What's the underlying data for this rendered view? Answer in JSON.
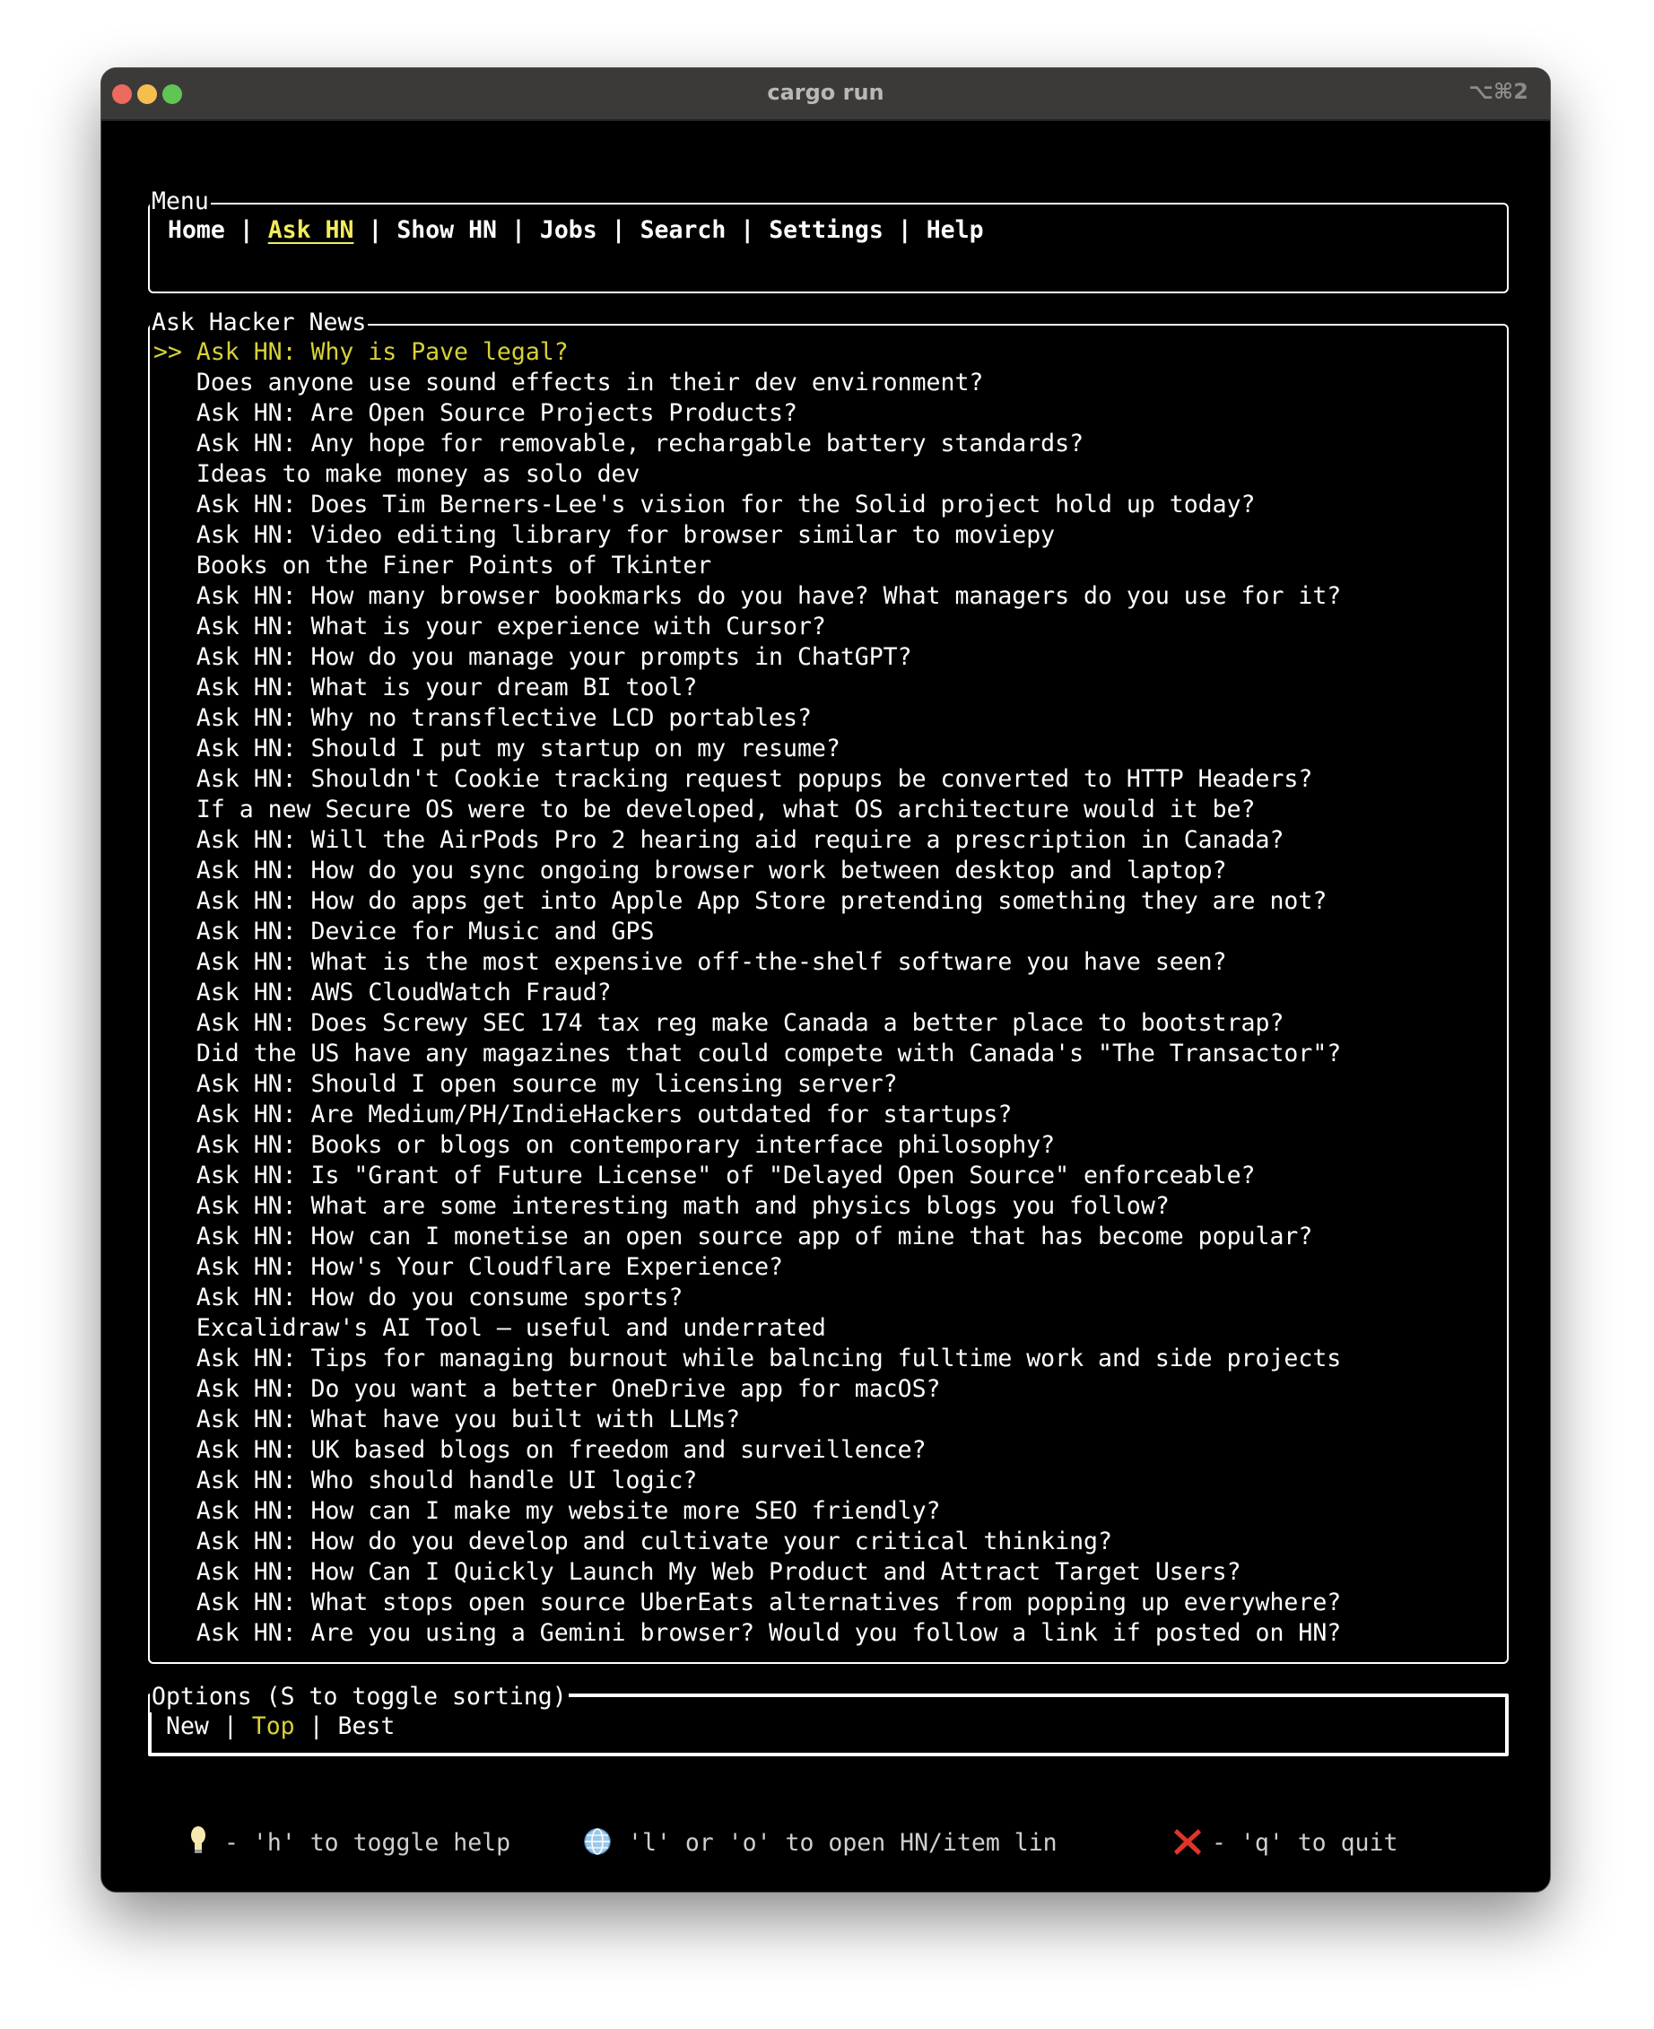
{
  "window": {
    "title": "cargo run",
    "shortcut": "⌥⌘2"
  },
  "menu": {
    "title": "Menu",
    "items": [
      "Home",
      "Ask HN",
      "Show HN",
      "Jobs",
      "Search",
      "Settings",
      "Help"
    ],
    "active": "Ask HN",
    "separator": "|"
  },
  "list": {
    "title": "Ask Hacker News",
    "cursor": ">>",
    "items": [
      "Ask HN: Why is Pave legal?",
      "Does anyone use sound effects in their dev environment?",
      "Ask HN: Are Open Source Projects Products?",
      "Ask HN: Any hope for removable, rechargable battery standards?",
      "Ideas to make money as solo dev",
      "Ask HN: Does Tim Berners-Lee's vision for the Solid project hold up today?",
      "Ask HN: Video editing library for browser similar to moviepy",
      "Books on the Finer Points of Tkinter",
      "Ask HN: How many browser bookmarks do you have? What managers do you use for it?",
      "Ask HN: What is your experience with Cursor?",
      "Ask HN: How do you manage your prompts in ChatGPT?",
      "Ask HN: What is your dream BI tool?",
      "Ask HN: Why no transflective LCD portables?",
      "Ask HN: Should I put my startup on my resume?",
      "Ask HN: Shouldn't Cookie tracking request popups be converted to HTTP Headers?",
      "If a new Secure OS were to be developed, what OS architecture would it be?",
      "Ask HN: Will the AirPods Pro 2 hearing aid require a prescription in Canada?",
      "Ask HN: How do you sync ongoing browser work between desktop and laptop?",
      "Ask HN: How do apps get into Apple App Store pretending something they are not?",
      "Ask HN: Device for Music and GPS",
      "Ask HN: What is the most expensive off-the-shelf software you have seen?",
      "Ask HN: AWS CloudWatch Fraud?",
      "Ask HN: Does Screwy SEC 174 tax reg make Canada a better place to bootstrap?",
      "Did the US have any magazines that could compete with Canada's \"The Transactor\"?",
      "Ask HN: Should I open source my licensing server?",
      "Ask HN: Are Medium/PH/IndieHackers outdated for startups?",
      "Ask HN: Books or blogs on contemporary interface philosophy?",
      "Ask HN: Is \"Grant of Future License\" of \"Delayed Open Source\" enforceable?",
      "Ask HN: What are some interesting math and physics blogs you follow?",
      "Ask HN: How can I monetise an open source app of mine that has become popular?",
      "Ask HN: How's Your Cloudflare Experience?",
      "Ask HN: How do you consume sports?",
      "Excalidraw's AI Tool – useful and underrated",
      "Ask HN: Tips for managing burnout while balncing fulltime work and side projects",
      "Ask HN: Do you want a better OneDrive app for macOS?",
      "Ask HN: What have you built with LLMs?",
      "Ask HN: UK based blogs on freedom and surveillence?",
      "Ask HN: Who should handle UI logic?",
      "Ask HN: How can I make my website more SEO friendly?",
      "Ask HN: How do you develop and cultivate your critical thinking?",
      "Ask HN: How Can I Quickly Launch My Web Product and Attract Target Users?",
      "Ask HN: What stops open source UberEats alternatives from popping up everywhere?",
      "Ask HN: Are you using a Gemini browser? Would you follow a link if posted on HN?"
    ]
  },
  "options": {
    "title": "Options (S to toggle sorting)",
    "items": [
      "New",
      "Top",
      "Best"
    ],
    "active": "Top"
  },
  "footer": {
    "help": "- 'h' to toggle help",
    "open": "'l' or 'o' to open HN/item lin",
    "quit": "- 'q' to quit",
    "icons": [
      "lightbulb-icon",
      "globe-icon",
      "cross-mark-icon"
    ]
  },
  "colors": {
    "accent": "#f2ec5c",
    "selected": "#d7d13a",
    "quit": "#e0352b"
  }
}
